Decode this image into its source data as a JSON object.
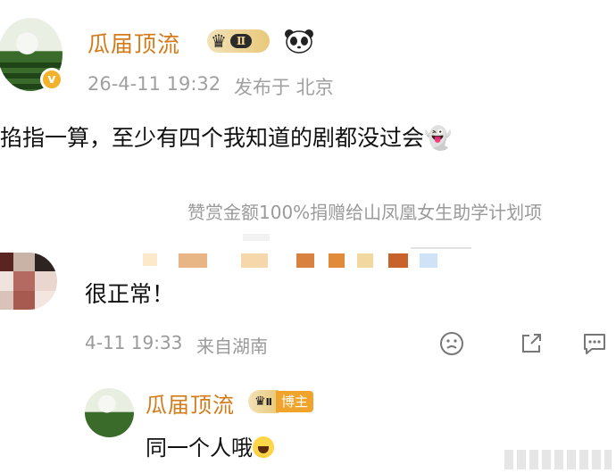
{
  "post": {
    "username": "瓜届顶流",
    "level_badge": "Ⅱ",
    "time": "26-4-11 19:32",
    "location": "发布于 北京",
    "text": "掐指一算，至少有四个我知道的剧都没过会👻",
    "donation_note": "赞赏金额100%捐赠给山凤凰女生助学计划项"
  },
  "comment": {
    "text": "很正常！",
    "time": "4-11 19:33",
    "location": "来自湖南",
    "actions": [
      "dislike-face-icon",
      "share-icon",
      "comment-icon"
    ]
  },
  "reply": {
    "username": "瓜届顶流",
    "level_badge": "Ⅱ",
    "owner_tag": "博主",
    "text": "同一个人哦"
  },
  "colors": {
    "username": "#d47a18",
    "meta_gray": "#a0a0a0",
    "verified_badge": "#f3b22b",
    "owner_tag": "#f0a42b"
  }
}
